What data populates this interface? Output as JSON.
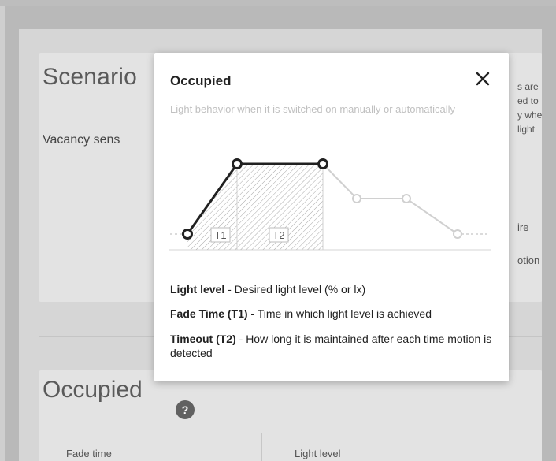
{
  "background": {
    "scenario_title": "Scenario",
    "vacancy_text": "Vacancy sens",
    "right_snippets": [
      "s are",
      "ed to",
      "y whe",
      "light"
    ],
    "right_wire": "ire",
    "right_motion": "otion",
    "occupied_title": "Occupied",
    "help_badge": "?",
    "fade_time_label": "Fade time",
    "light_level_label": "Light level"
  },
  "popup": {
    "title": "Occupied",
    "close_icon": "close-icon",
    "subtitle": "Light behavior when it is switched on manually or automatically",
    "graph": {
      "t1_label": "T1",
      "t2_label": "T2"
    },
    "legend": [
      {
        "term": "Light level",
        "desc": " - Desired light level (% or lx)"
      },
      {
        "term": "Fade Time (T1)",
        "desc": " - Time in which light level is achieved"
      },
      {
        "term": "Timeout (T2)",
        "desc": " - How long it is maintained after each time motion is detected"
      }
    ]
  },
  "colors": {
    "active_line": "#212121",
    "inactive_line": "#cfcfcf",
    "hatch": "#9e9e9e"
  }
}
